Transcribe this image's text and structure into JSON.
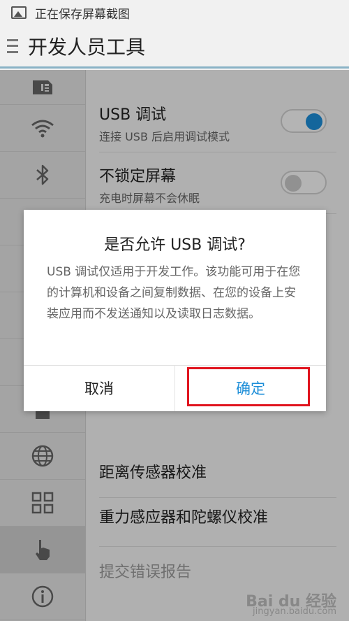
{
  "status_bar": {
    "text": "正在保存屏幕截图",
    "icon": "image-icon"
  },
  "app_bar": {
    "title": "开发人员工具",
    "menu_icon": "menu-icon"
  },
  "sidebar": {
    "items": [
      {
        "icon": "sim-card-icon"
      },
      {
        "icon": "wifi-icon"
      },
      {
        "icon": "bluetooth-icon"
      },
      {
        "icon": "blank"
      },
      {
        "icon": "blank"
      },
      {
        "icon": "blank"
      },
      {
        "icon": "blank"
      },
      {
        "icon": "lock-icon"
      },
      {
        "icon": "globe-icon"
      },
      {
        "icon": "apps-grid-icon"
      },
      {
        "icon": "hand-pointer-icon"
      },
      {
        "icon": "info-icon"
      }
    ]
  },
  "settings": {
    "usb_debug": {
      "title": "USB 调试",
      "subtitle": "连接 USB 后启用调试模式",
      "enabled": true
    },
    "stay_awake": {
      "title": "不锁定屏幕",
      "subtitle": "充电时屏幕不会休眠",
      "enabled": false
    },
    "proximity": {
      "title": "距离传感器校准"
    },
    "gravity": {
      "title": "重力感应器和陀螺仪校准"
    },
    "bug_report": {
      "title": "提交错误报告"
    }
  },
  "dialog": {
    "title": "是否允许 USB 调试?",
    "message": "USB 调试仅适用于开发工作。该功能可用于在您的计算机和设备之间复制数据、在您的设备上安装应用而不发送通知以及读取日志数据。",
    "cancel_label": "取消",
    "ok_label": "确定"
  },
  "watermark": {
    "logo": "Bai du 经验",
    "url": "jingyan.baidu.com"
  },
  "colors": {
    "accent": "#1d8ed8",
    "highlight": "#e0141e",
    "divider": "#8ab3c6"
  }
}
